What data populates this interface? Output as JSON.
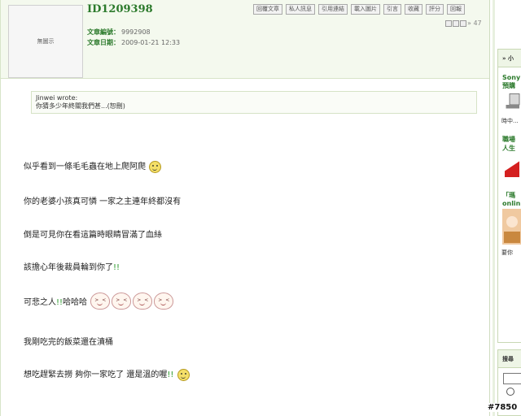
{
  "post": {
    "avatar_text": "無圖示",
    "username": "ID1209398",
    "posts_label": "文章編號：",
    "posts_value": "9992908",
    "date_label": "文章日期：",
    "date_value": "2009-01-21 12:33",
    "buttons": [
      "回覆文章",
      "私人訊息",
      "引用連結",
      "載入圖片",
      "引言",
      "收藏",
      "評分",
      "回報"
    ],
    "page_suffix": "» 47"
  },
  "quote": {
    "author": "Jinwei wrote:",
    "text": "你猜多少年終關我們甚...(恕刪)"
  },
  "body": {
    "p1": "似乎看到一條毛毛蟲在地上爬阿爬",
    "p2": "你的老婆小孩真可憐 一家之主連年終都沒有",
    "p3": "倒是可見你在看這篇時眼睛冒滿了血絲",
    "p4_text": "該擔心年後裁員輪到你了",
    "p4_mark": "!!",
    "p5_text": "可悲之人",
    "p5_mark": "!!",
    "p5_tail": "哈哈哈",
    "p6": "我剛吃完的飯菜還在濆桶",
    "p7_text": "想吃趕緊去撈 夠你一家吃了 還是溫的喔",
    "p7_mark": "!!"
  },
  "sidebar": {
    "box1_header": "» 小",
    "item1_title_a": "Sony",
    "item1_title_b": "預購",
    "item1_sub": "時中...",
    "item2_title_a": "職場",
    "item2_title_b": "人生",
    "item3_title_a": "「瑪",
    "item3_title_b": "onlin",
    "item3_sub": "要你",
    "box2_header": "搜尋"
  },
  "watermark": "#7850",
  "colors": {
    "accent_green": "#2c7a2c",
    "header_bg": "#f4f9ee",
    "border": "#d7e4c8"
  }
}
